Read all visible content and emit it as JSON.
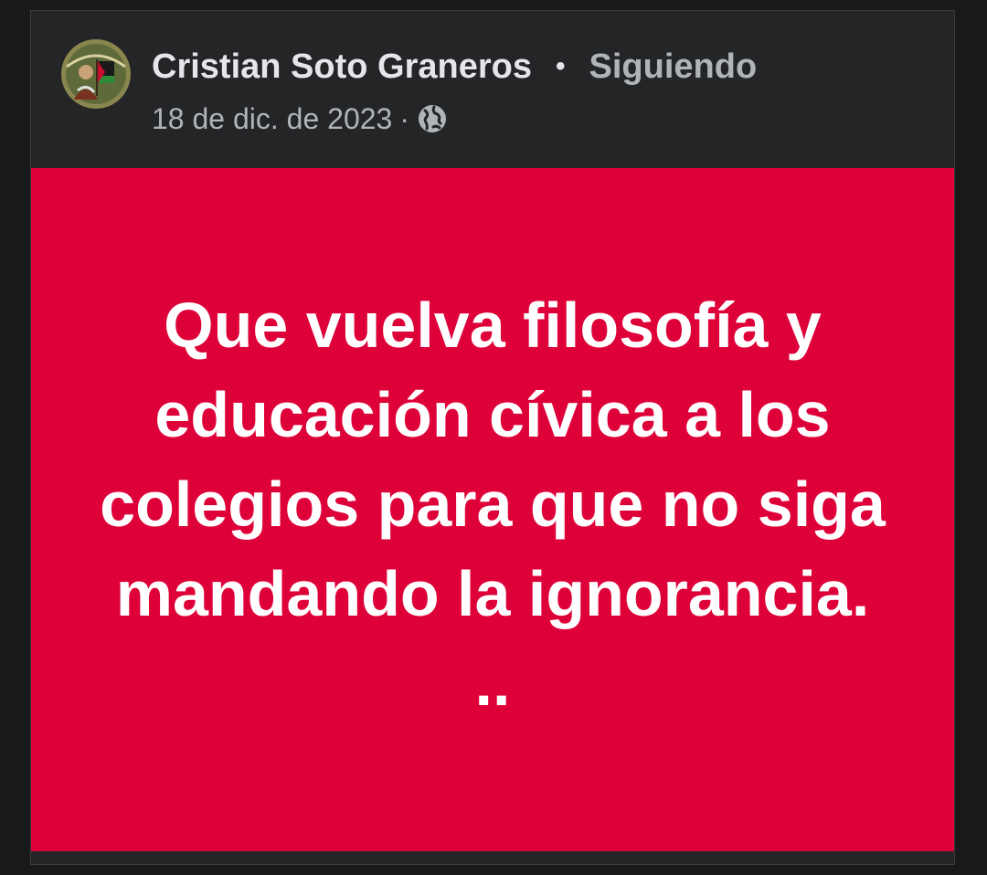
{
  "post": {
    "author": {
      "name": "Cristian Soto Graneros",
      "avatar_icon": "profile-photo-with-flag"
    },
    "separator": "•",
    "follow_status": "Siguiendo",
    "date": "18 de dic. de 2023",
    "meta_separator": "·",
    "privacy_icon": "globe-icon",
    "body_text": "Que vuelva filosofía y educación cívica a los colegios para que no siga mandando la ignorancia. ..",
    "colors": {
      "background_color": "#de0038",
      "card": "#242526",
      "name": "#e4e6eb",
      "secondary": "#b0b3b8"
    }
  }
}
